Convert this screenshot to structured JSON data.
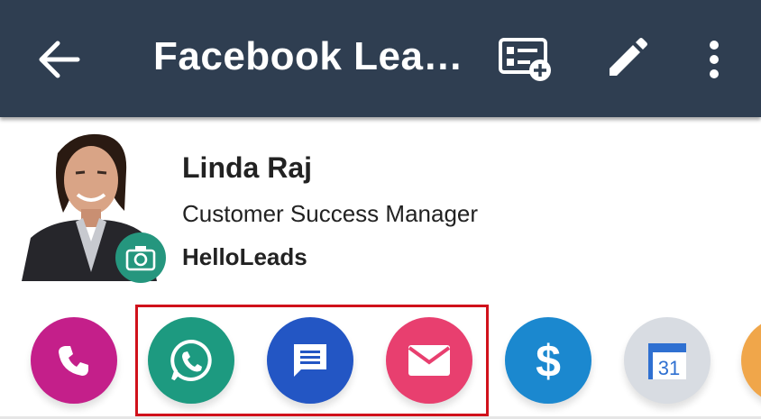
{
  "appbar": {
    "title": "Facebook Lea…",
    "back_icon": "arrow-back-icon",
    "actions": [
      "contact-card-add-icon",
      "pencil-edit-icon",
      "more-vert-icon"
    ]
  },
  "profile": {
    "name": "Linda Raj",
    "job_title": "Customer Success Manager",
    "company": "HelloLeads"
  },
  "contact_actions": [
    {
      "id": "call",
      "icon": "phone-icon",
      "color": "#c41f8a"
    },
    {
      "id": "whatsapp",
      "icon": "whatsapp-icon",
      "color": "#1d9a80"
    },
    {
      "id": "sms",
      "icon": "message-icon",
      "color": "#2356c4"
    },
    {
      "id": "email",
      "icon": "mail-icon",
      "color": "#e83f6f"
    },
    {
      "id": "deal",
      "icon": "dollar-icon",
      "color": "#1b88cf"
    },
    {
      "id": "calendar",
      "icon": "calendar-icon",
      "color": "#d8dce2",
      "label": "31"
    },
    {
      "id": "more",
      "icon": "partial-icon",
      "color": "#f0a64a"
    }
  ],
  "colors": {
    "appbar": "#2f3e51",
    "highlight": "#d0111b",
    "camera_badge": "#25967e"
  }
}
